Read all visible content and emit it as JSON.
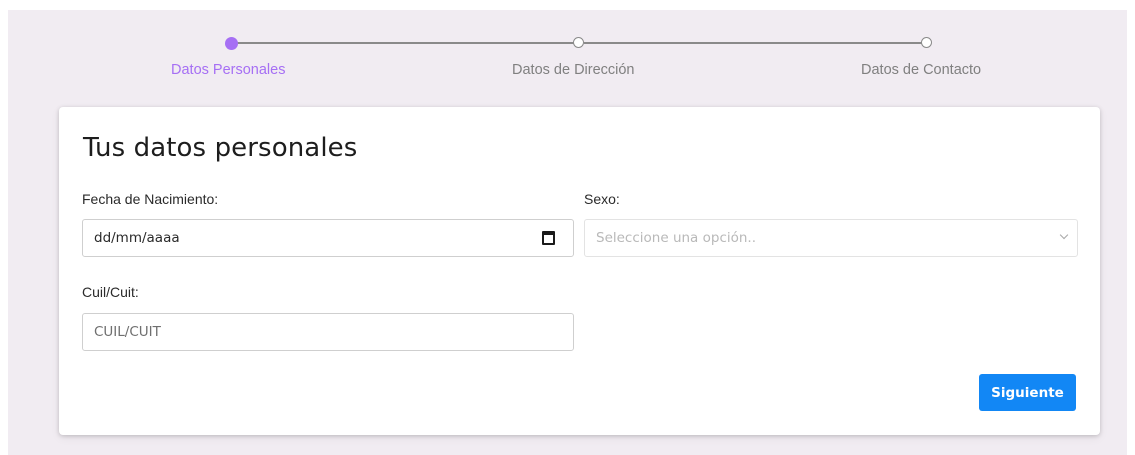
{
  "stepper": {
    "steps": [
      {
        "label": "Datos Personales",
        "state": "active"
      },
      {
        "label": "Datos de Dirección",
        "state": "inactive"
      },
      {
        "label": "Datos de Contacto",
        "state": "inactive"
      }
    ],
    "active_color": "#a66ff4",
    "inactive_color": "#808080"
  },
  "form": {
    "title": "Tus datos personales",
    "birth_date": {
      "label": "Fecha de Nacimiento:",
      "value": "dd/mm/aaaa",
      "icon": "calendar-icon"
    },
    "sex": {
      "label": "Sexo:",
      "placeholder": "Seleccione una opción..",
      "icon": "chevron-down-icon"
    },
    "cuil": {
      "label": "Cuil/Cuit:",
      "placeholder": "CUIL/CUIT"
    },
    "next_button": "Siguiente",
    "button_color": "#1287f5"
  }
}
